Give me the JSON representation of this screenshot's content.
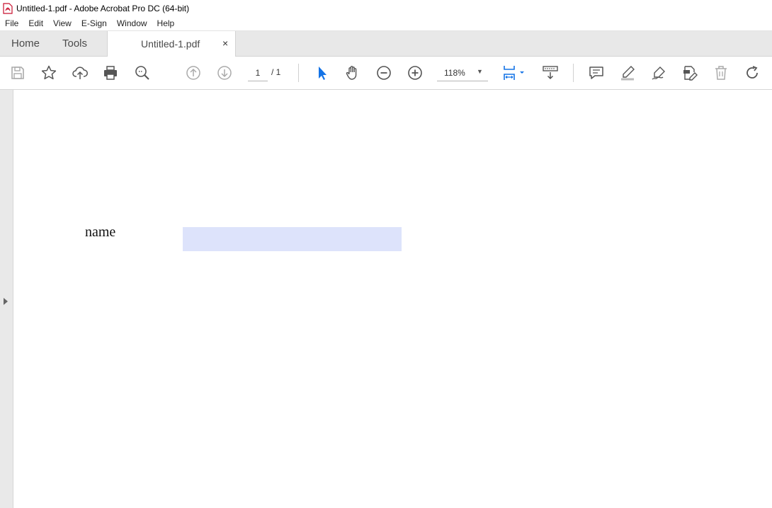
{
  "window": {
    "title": "Untitled-1.pdf - Adobe Acrobat Pro DC (64-bit)",
    "app_icon": "pdf-file-icon"
  },
  "menu": [
    "File",
    "Edit",
    "View",
    "E-Sign",
    "Window",
    "Help"
  ],
  "tabs": {
    "home": "Home",
    "tools": "Tools",
    "document": "Untitled-1.pdf",
    "close": "×"
  },
  "toolbar": {
    "icons": [
      "save-icon",
      "bookmark-star-icon",
      "upload-cloud-icon",
      "print-icon",
      "zoom-search-icon",
      "prev-page-icon",
      "next-page-icon",
      "select-cursor-icon",
      "hand-icon",
      "zoom-out-icon",
      "zoom-in-icon",
      "fit-page-icon",
      "scroll-mode-icon",
      "comment-icon",
      "highlight-icon",
      "draw-icon",
      "sign-icon",
      "delete-icon",
      "rotate-icon"
    ],
    "page_current": "1",
    "page_total": "/ 1",
    "zoom": "118%",
    "accent_color": "#1473e6"
  },
  "document": {
    "field_label": "name",
    "field_value": "",
    "field_color": "#dde3fb"
  }
}
